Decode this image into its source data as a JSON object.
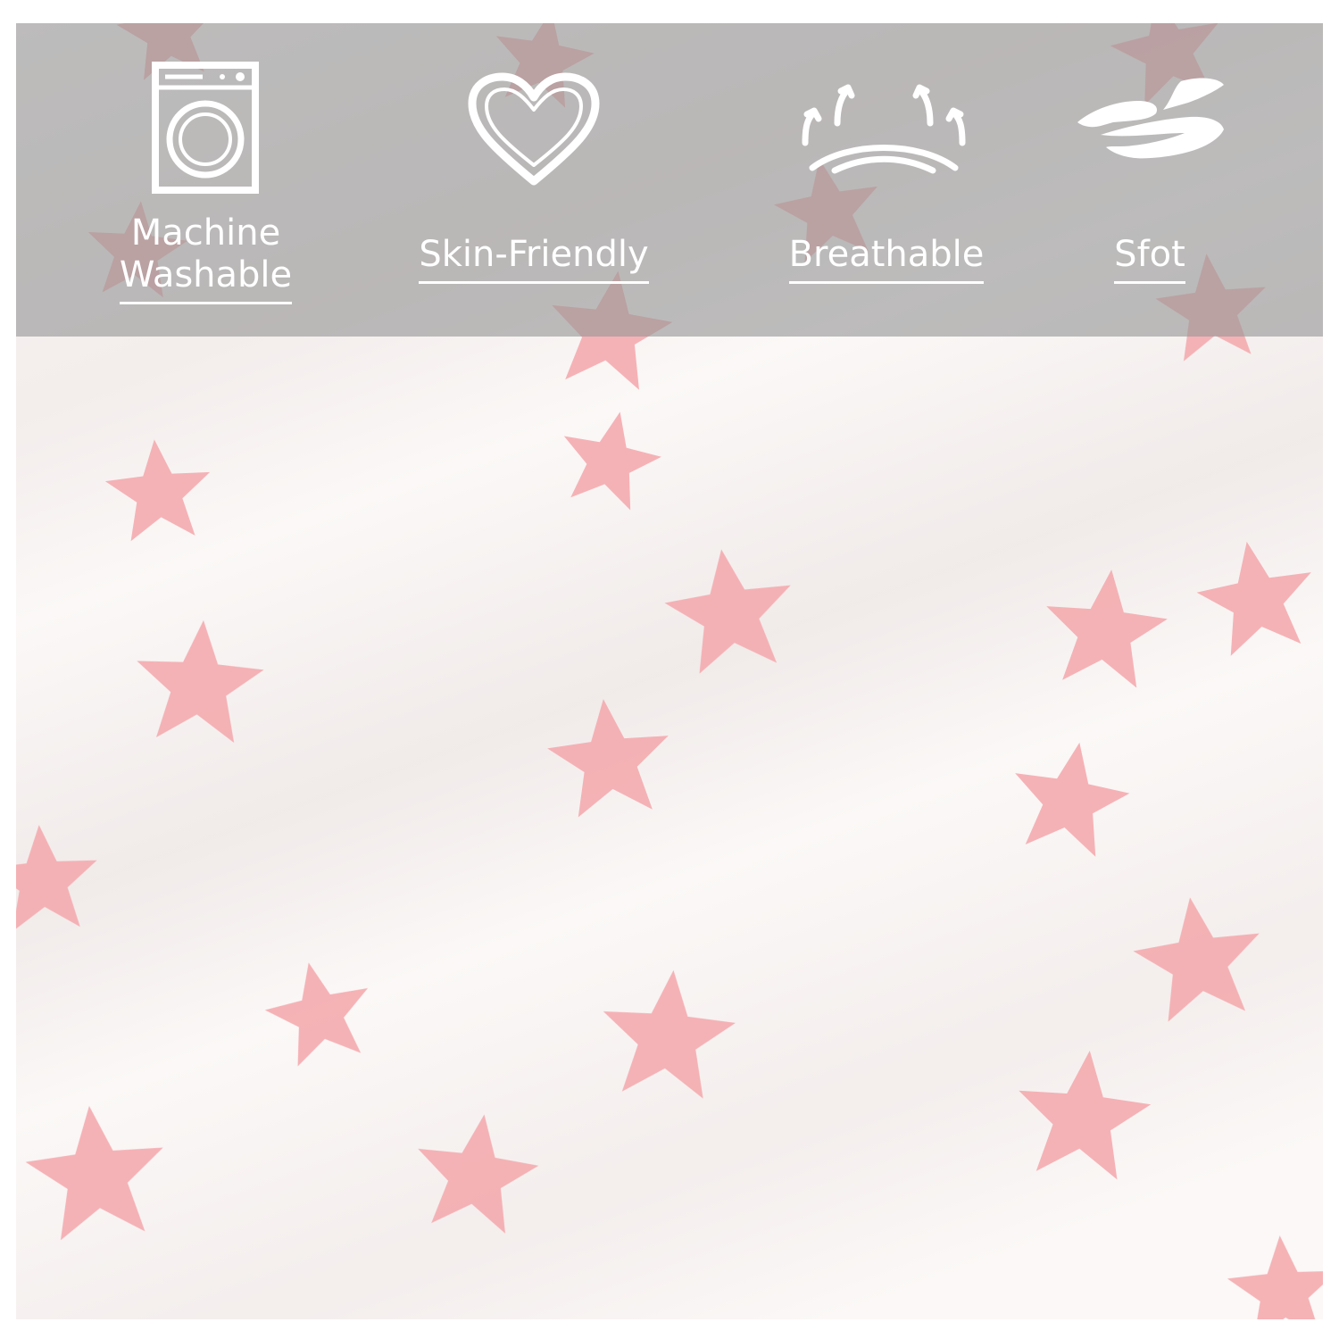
{
  "features": [
    {
      "icon": "washing-machine-icon",
      "line1": "Machine",
      "line2": "Washable"
    },
    {
      "icon": "heart-icon",
      "label": "Skin-Friendly"
    },
    {
      "icon": "breathable-arrows-icon",
      "label": "Breathable"
    },
    {
      "icon": "hand-feather-icon",
      "label": "Sfot"
    }
  ],
  "colors": {
    "banner": "#969696",
    "star": "#f4a9ad",
    "fabric": "#fbf8f7",
    "text": "#ffffff"
  }
}
